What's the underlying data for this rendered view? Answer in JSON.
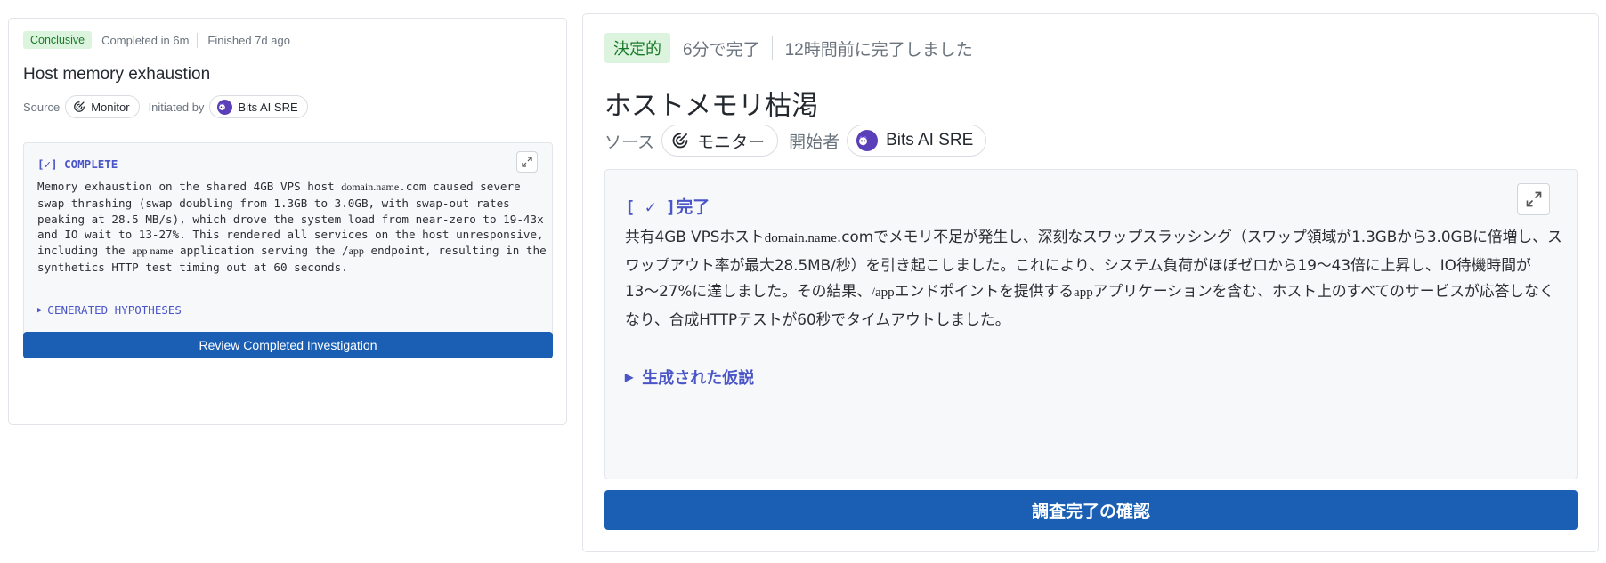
{
  "english": {
    "badge": "Conclusive",
    "completed": "Completed in 6m",
    "finished": "Finished 7d ago",
    "title": "Host memory exhaustion",
    "source_label": "Source",
    "source_value": "Monitor",
    "initiated_label": "Initiated by",
    "initiator": "Bits AI SRE",
    "status": "[✓] COMPLETE",
    "summary": {
      "p1": "Memory exhaustion on the shared 4GB VPS host ",
      "r1": "domain.name",
      "p2": ".com caused severe swap thrashing (swap doubling from 1.3GB to 3.0GB, with swap-out rates peaking at 28.5 MB/s), which drove the system load from near-zero to 19-43x and IO wait to 13-27%. This rendered all services on the host unresponsive, including the ",
      "r2": "app name",
      "p3": " application serving the /",
      "r3": "app",
      "p4": " endpoint, resulting in the synthetics HTTP test timing out at 60 seconds."
    },
    "hypotheses": "GENERATED HYPOTHESES",
    "button": "Review Completed Investigation"
  },
  "japanese": {
    "badge": "決定的",
    "completed": "6分で完了",
    "finished": "12時間前に完了しました",
    "title": "ホストメモリ枯渇",
    "source_label": "ソース",
    "source_value": "モニター",
    "initiated_label": "開始者",
    "initiator": "Bits AI SRE",
    "status": "[ ✓ ]完了",
    "summary": {
      "p1": "共有4GB VPSホスト",
      "r1": "domain.name",
      "p2": ".comでメモリ不足が発生し、深刻なスワップスラッシング（スワップ領域が1.3GBから3.0GBに倍増し、スワップアウト率が最大28.5MB/秒）を引き起こしました。これにより、システム負荷がほぼゼロから19〜43倍に上昇し、IO待機時間が13〜27%に達しました。その結果、",
      "r2": "/app",
      "p3": "エンドポイントを提供する",
      "r3": "app",
      "p4": "アプリケーションを含む、ホスト上のすべてのサービスが応答しなくなり、合成HTTPテストが60秒でタイムアウトしました。"
    },
    "hypotheses": "生成された仮説",
    "button": "調査完了の確認"
  },
  "colors": {
    "badge_bg": "#dcf4dd",
    "badge_text": "#1a7a2c",
    "accent": "#4a55c8",
    "primary_button": "#1a5fb4"
  },
  "icons": {
    "monitor": "monitor-icon",
    "avatar": "bits-ai-avatar",
    "expand": "expand-icon",
    "disclosure": "triangle-right-icon"
  }
}
